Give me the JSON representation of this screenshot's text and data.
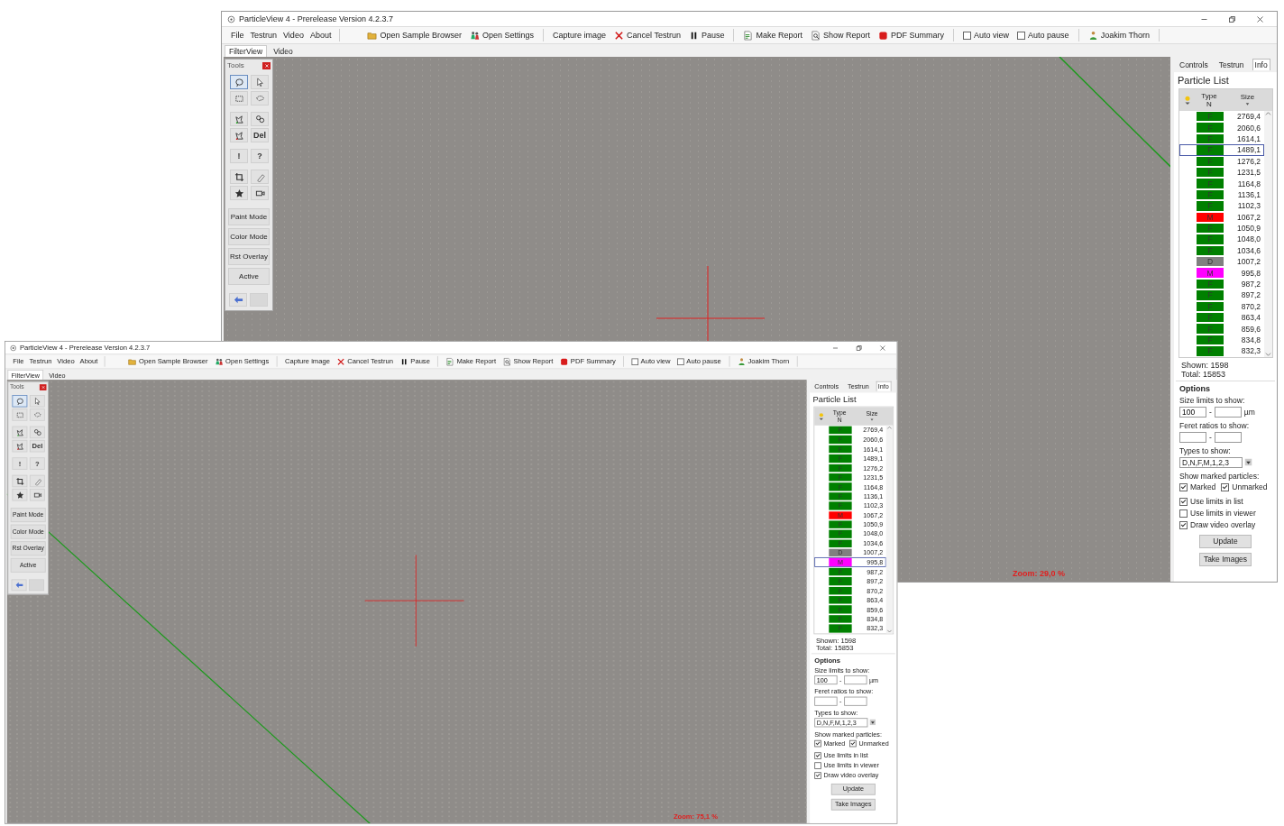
{
  "windows": [
    {
      "title": "ParticleView 4 - Prerelease Version 4.2.3.7",
      "menu": [
        "File",
        "Testrun",
        "Video",
        "About"
      ],
      "toolbar": [
        [
          {
            "kind": "button",
            "label": "Open Sample Browser"
          },
          {
            "kind": "button",
            "label": "Open Settings"
          }
        ],
        [
          {
            "kind": "button",
            "label": "Capture image"
          },
          {
            "kind": "button",
            "label": "Cancel Testrun"
          },
          {
            "kind": "button",
            "label": "Pause"
          }
        ],
        [
          {
            "kind": "button",
            "label": "Make Report"
          },
          {
            "kind": "button",
            "label": "Show Report"
          },
          {
            "kind": "button",
            "label": "PDF Summary"
          }
        ],
        [
          {
            "kind": "checkbox",
            "label": "Auto view",
            "checked": false
          },
          {
            "kind": "checkbox",
            "label": "Auto pause",
            "checked": false
          }
        ],
        [
          {
            "kind": "button",
            "label": "Joakim Thorn"
          }
        ]
      ],
      "view_tabs": [
        {
          "label": "FilterView",
          "selected": true
        },
        {
          "label": "Video",
          "selected": false
        }
      ],
      "tools": {
        "title": "Tools",
        "grid": [
          {
            "kind": "icon",
            "selected": true
          },
          {
            "kind": "icon",
            "selected": false
          },
          {
            "kind": "icon",
            "selected": false
          },
          {
            "kind": "icon",
            "selected": false
          },
          {
            "kind": "icon",
            "selected": false
          },
          {
            "kind": "icon",
            "selected": false
          },
          {
            "kind": "icon",
            "selected": false
          },
          {
            "kind": "text",
            "label": "Del",
            "selected": false
          },
          {
            "kind": "text",
            "label": "!",
            "selected": false
          },
          {
            "kind": "text",
            "label": "?",
            "selected": false
          },
          {
            "kind": "icon",
            "selected": false
          },
          {
            "kind": "icon",
            "selected": false
          },
          {
            "kind": "icon",
            "selected": false
          },
          {
            "kind": "icon",
            "selected": false
          }
        ],
        "modes": [
          "Paint Mode",
          "Color Mode",
          "Rst Overlay",
          "Active"
        ],
        "nav": [
          {
            "disabled": false
          },
          {
            "disabled": true
          }
        ]
      },
      "viewer": {
        "zoom": "Zoom: 29,0 %"
      },
      "side_tabs": [
        {
          "label": "Controls",
          "selected": false
        },
        {
          "label": "Testrun",
          "selected": false
        },
        {
          "label": "Info",
          "selected": true
        }
      ],
      "particle_list": {
        "title": "Particle List",
        "type_label": "Type",
        "type_sub": "N",
        "size_label": "Size",
        "rows": [
          {
            "type": "F",
            "size": "2769,4",
            "color": "#008000",
            "selected": false
          },
          {
            "type": "F",
            "size": "2060,6",
            "color": "#008000",
            "selected": false
          },
          {
            "type": "F",
            "size": "1614,1",
            "color": "#008000",
            "selected": false
          },
          {
            "type": "F",
            "size": "1489,1",
            "color": "#008000",
            "selected": true
          },
          {
            "type": "F",
            "size": "1276,2",
            "color": "#008000",
            "selected": false
          },
          {
            "type": "F",
            "size": "1231,5",
            "color": "#008000",
            "selected": false
          },
          {
            "type": "F",
            "size": "1164,8",
            "color": "#008000",
            "selected": false
          },
          {
            "type": "F",
            "size": "1136,1",
            "color": "#008000",
            "selected": false
          },
          {
            "type": "F",
            "size": "1102,3",
            "color": "#008000",
            "selected": false
          },
          {
            "type": "M",
            "size": "1067,2",
            "color": "#ff0000",
            "selected": false
          },
          {
            "type": "F",
            "size": "1050,9",
            "color": "#008000",
            "selected": false
          },
          {
            "type": "F",
            "size": "1048,0",
            "color": "#008000",
            "selected": false
          },
          {
            "type": "F",
            "size": "1034,6",
            "color": "#008000",
            "selected": false
          },
          {
            "type": "D",
            "size": "1007,2",
            "color": "#808080",
            "selected": false
          },
          {
            "type": "M",
            "size": "995,8",
            "color": "#ff00ff",
            "selected": false
          },
          {
            "type": "F",
            "size": "987,2",
            "color": "#008000",
            "selected": false
          },
          {
            "type": "F",
            "size": "897,2",
            "color": "#008000",
            "selected": false
          },
          {
            "type": "F",
            "size": "870,2",
            "color": "#008000",
            "selected": false
          },
          {
            "type": "F",
            "size": "863,4",
            "color": "#008000",
            "selected": false
          },
          {
            "type": "F",
            "size": "859,6",
            "color": "#008000",
            "selected": false
          },
          {
            "type": "F",
            "size": "834,8",
            "color": "#008000",
            "selected": false
          },
          {
            "type": "F",
            "size": "832,3",
            "color": "#008000",
            "selected": false
          }
        ],
        "shown": "Shown: 1598",
        "total": "Total: 15853"
      },
      "options": {
        "title": "Options",
        "size_label": "Size limits to show:",
        "size_min": "100",
        "size_sep": "-",
        "size_unit": "µm",
        "feret_label": "Feret ratios to show:",
        "feret_sep": "-",
        "types_label": "Types to show:",
        "types_value": "D,N,F,M,1,2,3",
        "marked_label": "Show marked particles:",
        "marked": [
          {
            "label": "Marked",
            "checked": true
          },
          {
            "label": "Unmarked",
            "checked": true
          }
        ],
        "limits": [
          {
            "label": "Use limits in list",
            "checked": true
          },
          {
            "label": "Use limits in viewer",
            "checked": false
          },
          {
            "label": "Draw video overlay",
            "checked": true
          }
        ],
        "buttons": [
          "Update",
          "Take Images"
        ]
      }
    },
    {
      "title": "ParticleView 4 - Prerelease Version 4.2.3.7",
      "menu": [
        "File",
        "Testrun",
        "Video",
        "About"
      ],
      "toolbar": [
        [
          {
            "kind": "button",
            "label": "Open Sample Browser"
          },
          {
            "kind": "button",
            "label": "Open Settings"
          }
        ],
        [
          {
            "kind": "button",
            "label": "Capture image"
          },
          {
            "kind": "button",
            "label": "Cancel Testrun"
          },
          {
            "kind": "button",
            "label": "Pause"
          }
        ],
        [
          {
            "kind": "button",
            "label": "Make Report"
          },
          {
            "kind": "button",
            "label": "Show Report"
          },
          {
            "kind": "button",
            "label": "PDF Summary"
          }
        ],
        [
          {
            "kind": "checkbox",
            "label": "Auto view",
            "checked": false
          },
          {
            "kind": "checkbox",
            "label": "Auto pause",
            "checked": false
          }
        ],
        [
          {
            "kind": "button",
            "label": "Joakim Thorn"
          }
        ]
      ],
      "view_tabs": [
        {
          "label": "FilterView",
          "selected": true
        },
        {
          "label": "Video",
          "selected": false
        }
      ],
      "tools": {
        "title": "Tools",
        "grid": [
          {
            "kind": "icon",
            "selected": true
          },
          {
            "kind": "icon",
            "selected": false
          },
          {
            "kind": "icon",
            "selected": false
          },
          {
            "kind": "icon",
            "selected": false
          },
          {
            "kind": "icon",
            "selected": false
          },
          {
            "kind": "icon",
            "selected": false
          },
          {
            "kind": "icon",
            "selected": false
          },
          {
            "kind": "text",
            "label": "Del",
            "selected": false
          },
          {
            "kind": "text",
            "label": "!",
            "selected": false
          },
          {
            "kind": "text",
            "label": "?",
            "selected": false
          },
          {
            "kind": "icon",
            "selected": false
          },
          {
            "kind": "icon",
            "selected": false
          },
          {
            "kind": "icon",
            "selected": false
          },
          {
            "kind": "icon",
            "selected": false
          }
        ],
        "modes": [
          "Paint Mode",
          "Color Mode",
          "Rst Overlay",
          "Active"
        ],
        "nav": [
          {
            "disabled": false
          },
          {
            "disabled": true
          }
        ]
      },
      "viewer": {
        "zoom": "Zoom: 75,1 %"
      },
      "side_tabs": [
        {
          "label": "Controls",
          "selected": false
        },
        {
          "label": "Testrun",
          "selected": false
        },
        {
          "label": "Info",
          "selected": true
        }
      ],
      "particle_list": {
        "title": "Particle List",
        "type_label": "Type",
        "type_sub": "N",
        "size_label": "Size",
        "rows": [
          {
            "type": "F",
            "size": "2769,4",
            "color": "#008000",
            "selected": false
          },
          {
            "type": "F",
            "size": "2060,6",
            "color": "#008000",
            "selected": false
          },
          {
            "type": "F",
            "size": "1614,1",
            "color": "#008000",
            "selected": false
          },
          {
            "type": "F",
            "size": "1489,1",
            "color": "#008000",
            "selected": false
          },
          {
            "type": "F",
            "size": "1276,2",
            "color": "#008000",
            "selected": false
          },
          {
            "type": "F",
            "size": "1231,5",
            "color": "#008000",
            "selected": false
          },
          {
            "type": "F",
            "size": "1164,8",
            "color": "#008000",
            "selected": false
          },
          {
            "type": "F",
            "size": "1136,1",
            "color": "#008000",
            "selected": false
          },
          {
            "type": "F",
            "size": "1102,3",
            "color": "#008000",
            "selected": false
          },
          {
            "type": "M",
            "size": "1067,2",
            "color": "#ff0000",
            "selected": false
          },
          {
            "type": "F",
            "size": "1050,9",
            "color": "#008000",
            "selected": false
          },
          {
            "type": "F",
            "size": "1048,0",
            "color": "#008000",
            "selected": false
          },
          {
            "type": "F",
            "size": "1034,6",
            "color": "#008000",
            "selected": false
          },
          {
            "type": "D",
            "size": "1007,2",
            "color": "#808080",
            "selected": false
          },
          {
            "type": "M",
            "size": "995,8",
            "color": "#ff00ff",
            "selected": true
          },
          {
            "type": "F",
            "size": "987,2",
            "color": "#008000",
            "selected": false
          },
          {
            "type": "F",
            "size": "897,2",
            "color": "#008000",
            "selected": false
          },
          {
            "type": "F",
            "size": "870,2",
            "color": "#008000",
            "selected": false
          },
          {
            "type": "F",
            "size": "863,4",
            "color": "#008000",
            "selected": false
          },
          {
            "type": "F",
            "size": "859,6",
            "color": "#008000",
            "selected": false
          },
          {
            "type": "F",
            "size": "834,8",
            "color": "#008000",
            "selected": false
          },
          {
            "type": "F",
            "size": "832,3",
            "color": "#008000",
            "selected": false
          }
        ],
        "shown": "Shown: 1598",
        "total": "Total: 15853"
      },
      "options": {
        "title": "Options",
        "size_label": "Size limits to show:",
        "size_min": "100",
        "size_sep": "-",
        "size_unit": "µm",
        "feret_label": "Feret ratios to show:",
        "feret_sep": "-",
        "types_label": "Types to show:",
        "types_value": "D,N,F,M,1,2,3",
        "marked_label": "Show marked particles:",
        "marked": [
          {
            "label": "Marked",
            "checked": true
          },
          {
            "label": "Unmarked",
            "checked": true
          }
        ],
        "limits": [
          {
            "label": "Use limits in list",
            "checked": true
          },
          {
            "label": "Use limits in viewer",
            "checked": false
          },
          {
            "label": "Draw video overlay",
            "checked": true
          }
        ],
        "buttons": [
          "Update",
          "Take Images"
        ]
      }
    }
  ]
}
